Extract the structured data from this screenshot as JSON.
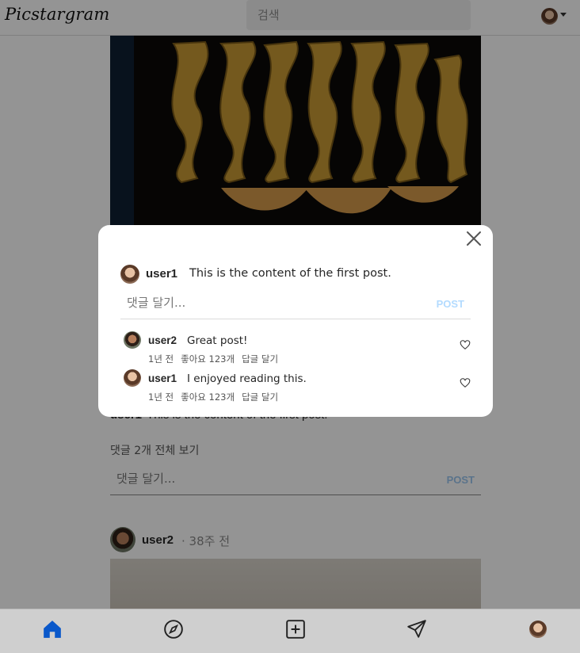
{
  "app": {
    "logo": "Picstargram"
  },
  "search": {
    "placeholder": "검색"
  },
  "feed": {
    "caption_user": "user1",
    "caption_text": "This is the content of the first post.",
    "view_all": "댓글 2개 전체 보기",
    "comment_placeholder": "댓글 달기...",
    "post_label": "POST",
    "post2_user": "user2",
    "post2_time": "· 38주 전"
  },
  "modal": {
    "post_user": "user1",
    "post_text": "This is the content of the first post.",
    "comment_placeholder": "댓글 달기...",
    "post_label": "POST",
    "comments": [
      {
        "user": "user2",
        "text": "Great post!",
        "time": "1년 전",
        "likes": "좋아요 123개",
        "reply": "답글 달기"
      },
      {
        "user": "user1",
        "text": "I enjoyed reading this.",
        "time": "1년 전",
        "likes": "좋아요 123개",
        "reply": "답글 달기"
      }
    ]
  },
  "icons": {
    "close": "close-icon",
    "heart": "heart-icon",
    "home": "home-icon",
    "explore": "compass-icon",
    "create": "plus-square-icon",
    "messages": "send-icon"
  },
  "colors": {
    "active_nav": "#0a58ca",
    "post_button": "#b3dbff"
  }
}
